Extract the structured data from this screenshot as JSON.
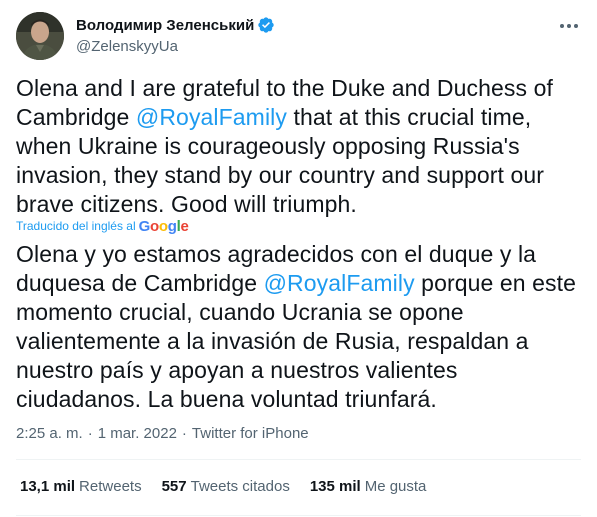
{
  "author": {
    "display_name": "Володимир Зеленський",
    "handle": "@ZelenskyyUa",
    "verified_icon": "verified-badge-icon",
    "avatar": "avatar-photo"
  },
  "colors": {
    "link": "#1d9bf0",
    "text": "#0f1419",
    "secondary": "#536471"
  },
  "tweet": {
    "en": {
      "part1": "Olena and I are grateful to the Duke and Duchess of Cambridge ",
      "mention": "@RoyalFamily",
      "part2": " that at this crucial time, when Ukraine is courageously opposing Russia's invasion, they stand by our country and support our brave citizens.  Good will triumph."
    },
    "translated_label": "Traducido del inglés al",
    "translator": "Google",
    "es": {
      "part1": "Olena y yo estamos agradecidos con el duque y la duquesa de Cambridge ",
      "mention": "@RoyalFamily",
      "part2": " porque en este momento crucial, cuando Ucrania se opone valientemente a la invasión de Rusia, respaldan a nuestro país y apoyan a nuestros valientes ciudadanos. La buena voluntad triunfará."
    }
  },
  "meta": {
    "time": "2:25 a. m.",
    "date": "1 mar. 2022",
    "source": "Twitter for iPhone",
    "separator": "·"
  },
  "stats": [
    {
      "count": "13,1 mil",
      "label": "Retweets"
    },
    {
      "count": "557",
      "label": "Tweets citados"
    },
    {
      "count": "135 mil",
      "label": "Me gusta"
    }
  ]
}
